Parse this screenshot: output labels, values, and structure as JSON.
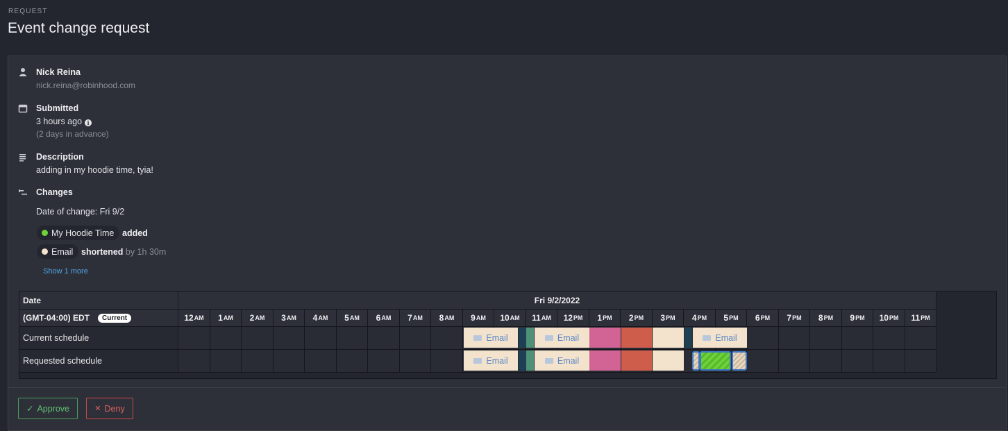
{
  "header": {
    "kicker": "REQUEST",
    "title": "Event change request"
  },
  "requester": {
    "name": "Nick Reina",
    "email": "nick.reina@robinhood.com"
  },
  "submitted": {
    "label": "Submitted",
    "time": "3 hours ago",
    "advance": "(2 days in advance)"
  },
  "description": {
    "label": "Description",
    "text": "adding in my hoodie time, tyia!"
  },
  "changes": {
    "label": "Changes",
    "date_of_change": "Date of change: Fri 9/2",
    "items": [
      {
        "event": "My Hoodie Time",
        "status": "added",
        "extra": "",
        "color": "#6dd33a"
      },
      {
        "event": "Email",
        "status": "shortened",
        "extra": "by 1h 30m",
        "color": "#f3e3cc"
      }
    ],
    "show_more": "Show 1 more"
  },
  "schedule": {
    "date_header": "Date",
    "date_value": "Fri 9/2/2022",
    "timezone": "(GMT-04:00) EDT",
    "current_badge": "Current",
    "rows": [
      "Current schedule",
      "Requested schedule"
    ],
    "hours": [
      {
        "h": "12",
        "p": "AM"
      },
      {
        "h": "1",
        "p": "AM"
      },
      {
        "h": "2",
        "p": "AM"
      },
      {
        "h": "3",
        "p": "AM"
      },
      {
        "h": "4",
        "p": "AM"
      },
      {
        "h": "5",
        "p": "AM"
      },
      {
        "h": "6",
        "p": "AM"
      },
      {
        "h": "7",
        "p": "AM"
      },
      {
        "h": "8",
        "p": "AM"
      },
      {
        "h": "9",
        "p": "AM"
      },
      {
        "h": "10",
        "p": "AM"
      },
      {
        "h": "11",
        "p": "AM"
      },
      {
        "h": "12",
        "p": "PM"
      },
      {
        "h": "1",
        "p": "PM"
      },
      {
        "h": "2",
        "p": "PM"
      },
      {
        "h": "3",
        "p": "PM"
      },
      {
        "h": "4",
        "p": "PM"
      },
      {
        "h": "5",
        "p": "PM"
      },
      {
        "h": "6",
        "p": "PM"
      },
      {
        "h": "7",
        "p": "PM"
      },
      {
        "h": "8",
        "p": "PM"
      },
      {
        "h": "9",
        "p": "PM"
      },
      {
        "h": "10",
        "p": "PM"
      },
      {
        "h": "11",
        "p": "PM"
      }
    ],
    "email_label": "Email"
  },
  "actions": {
    "approve": "Approve",
    "deny": "Deny"
  }
}
